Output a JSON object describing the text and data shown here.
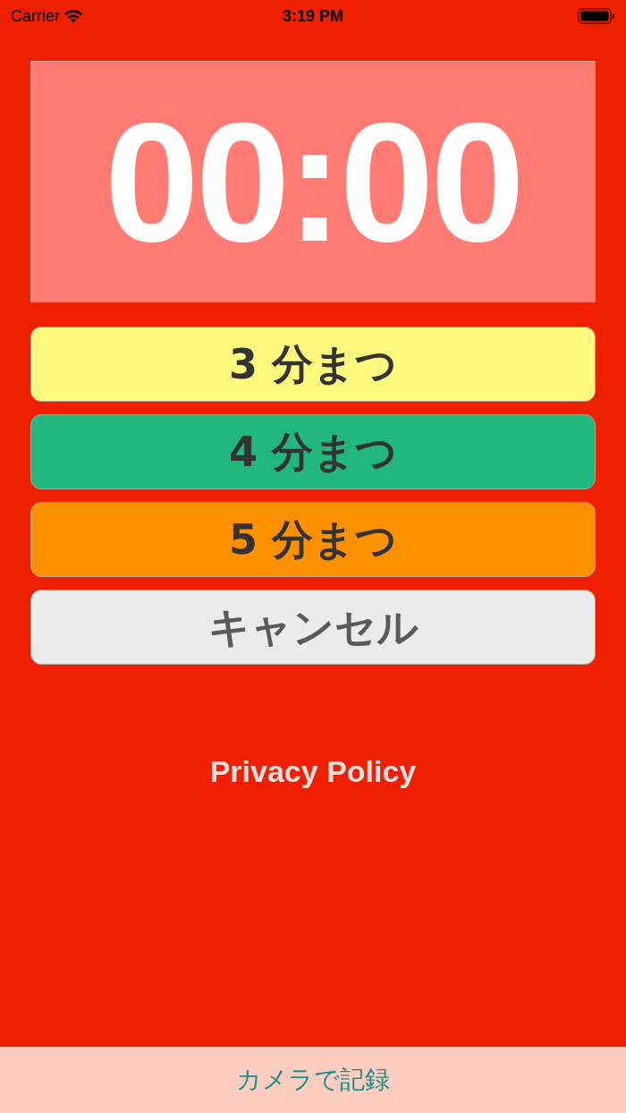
{
  "status_bar": {
    "carrier": "Carrier",
    "time": "3:19 PM"
  },
  "timer": {
    "display": "00:00"
  },
  "buttons": [
    {
      "label": "3 分まつ",
      "kind": "timer",
      "color": "#fffa7d"
    },
    {
      "label": "4 分まつ",
      "kind": "timer",
      "color": "#22b77e"
    },
    {
      "label": "5 分まつ",
      "kind": "timer",
      "color": "#ff9000"
    },
    {
      "label": "キャンセル",
      "kind": "cancel",
      "color": "#ebebeb"
    }
  ],
  "privacy_link": "Privacy Policy",
  "bottom_bar": {
    "label": "カメラで記録"
  }
}
